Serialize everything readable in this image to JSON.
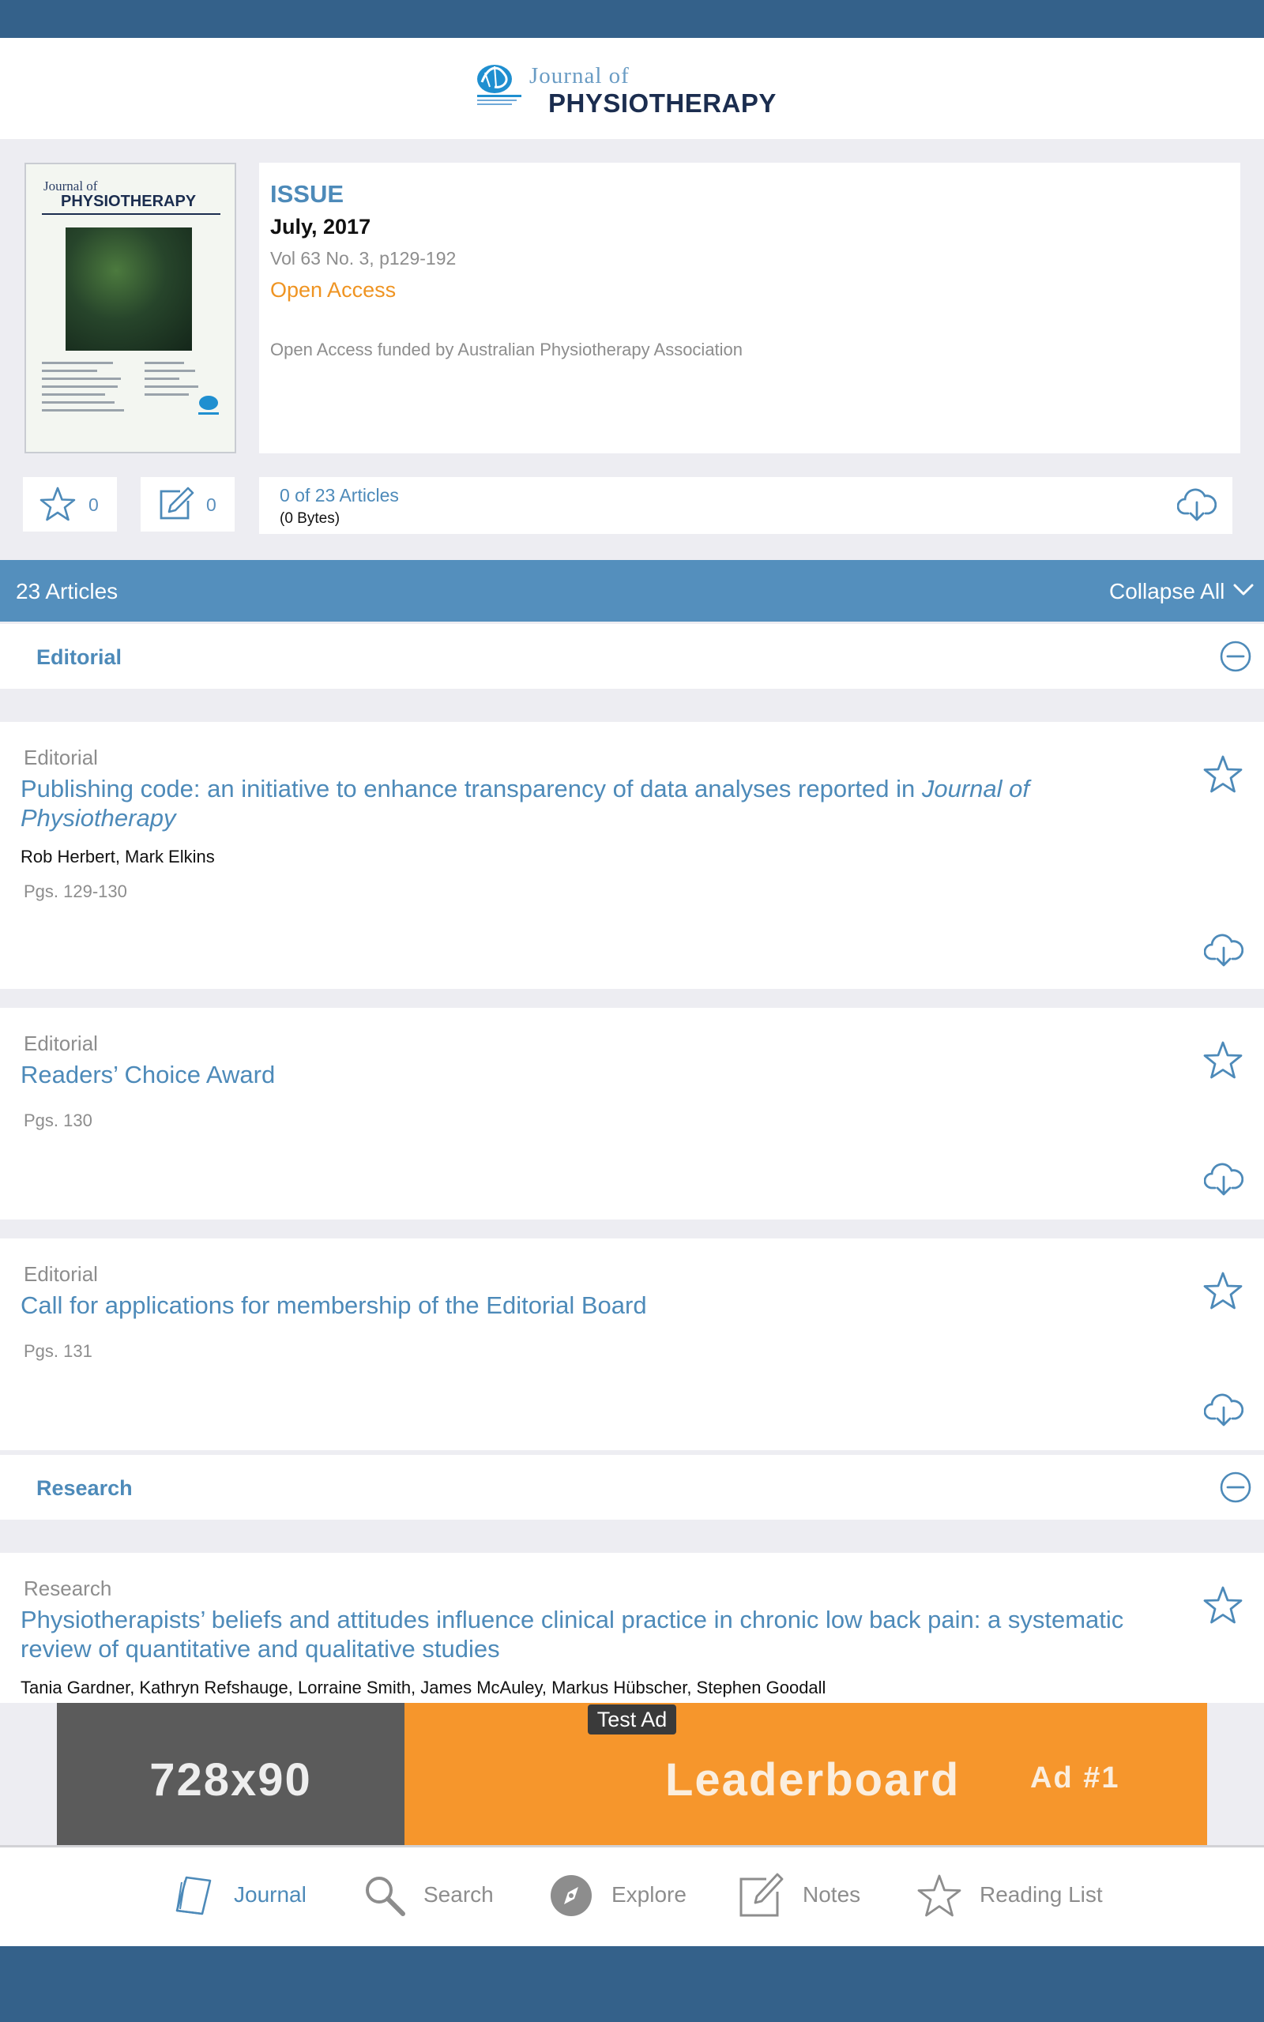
{
  "header": {
    "logo_top": "Journal of",
    "logo_main": "PHYSIOTHERAPY"
  },
  "cover": {
    "title1": "Journal of",
    "title2": "PHYSIOTHERAPY"
  },
  "issue": {
    "label": "ISSUE",
    "date": "July, 2017",
    "volume": "Vol 63 No. 3, p129-192",
    "access": "Open Access",
    "funded": "Open Access funded by Australian Physiotherapy Association"
  },
  "counters": {
    "favorites": "0",
    "notes": "0"
  },
  "download": {
    "count": "0 of 23 Articles",
    "size": "(0 Bytes)"
  },
  "articles_bar": {
    "count": "23 Articles",
    "collapse": "Collapse All"
  },
  "sections": [
    {
      "title": "Editorial",
      "articles": [
        {
          "category": "Editorial",
          "title": "Publishing code: an initiative to enhance transparency of data analyses reported in",
          "title_italic": "Journal of Physiotherapy",
          "authors": "Rob Herbert, Mark Elkins",
          "pages": "Pgs. 129-130"
        },
        {
          "category": "Editorial",
          "title": "Readers’ Choice Award",
          "pages": "Pgs. 130"
        },
        {
          "category": "Editorial",
          "title": "Call for applications for membership of the Editorial Board",
          "pages": "Pgs. 131"
        }
      ]
    },
    {
      "title": "Research",
      "articles": [
        {
          "category": "Research",
          "title": "Physiotherapists’ beliefs and attitudes influence clinical practice in chronic low back pain: a systematic review of quantitative and qualitative studies",
          "authors": "Tania Gardner, Kathryn Refshauge, Lorraine Smith, James McAuley, Markus Hübscher, Stephen Goodall"
        }
      ]
    }
  ],
  "ad": {
    "badge": "Test Ad",
    "size": "728x90",
    "name": "Leaderboard",
    "number": "Ad #1"
  },
  "tabs": [
    {
      "label": "Journal",
      "icon": "journal-icon",
      "active": true
    },
    {
      "label": "Search",
      "icon": "search-icon",
      "active": false
    },
    {
      "label": "Explore",
      "icon": "compass-icon",
      "active": false
    },
    {
      "label": "Notes",
      "icon": "notes-icon",
      "active": false
    },
    {
      "label": "Reading List",
      "icon": "star-icon",
      "active": false
    }
  ],
  "colors": {
    "system_bar": "#34618a",
    "accent": "#4d8ab9",
    "articles_bar": "#548fbd",
    "open_access": "#ef9422",
    "ad_orange": "#f6962c"
  }
}
